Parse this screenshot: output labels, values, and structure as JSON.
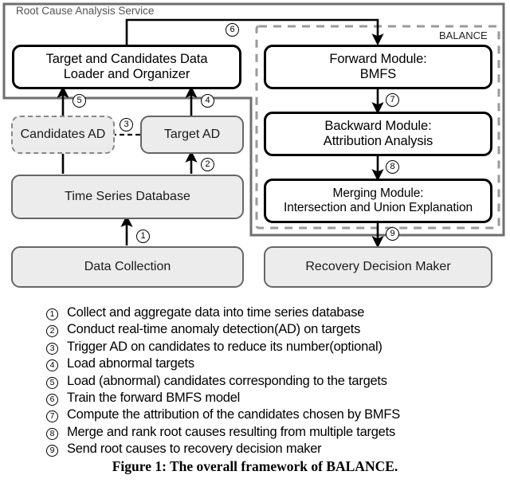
{
  "containers": {
    "service": {
      "label": "Root Cause Analysis Service"
    },
    "balance": {
      "label": "BALANCE"
    }
  },
  "nodes": {
    "data_loader": {
      "line1": "Target and Candidates Data",
      "line2": "Loader and Organizer"
    },
    "forward": {
      "line1": "Forward Module:",
      "line2": "BMFS"
    },
    "backward": {
      "line1": "Backward Module:",
      "line2": "Attribution Analysis"
    },
    "merging": {
      "line1": "Merging Module:",
      "line2": "Intersection and Union Explanation"
    },
    "candidates_ad": {
      "line1": "Candidates AD"
    },
    "target_ad": {
      "line1": "Target AD"
    },
    "tsdb": {
      "line1": "Time Series Database"
    },
    "data_collect": {
      "line1": "Data Collection"
    },
    "recovery": {
      "line1": "Recovery Decision Maker"
    }
  },
  "steps": {
    "s1": "1",
    "s2": "2",
    "s3": "3",
    "s4": "4",
    "s5": "5",
    "s6": "6",
    "s7": "7",
    "s8": "8",
    "s9": "9"
  },
  "legend": [
    {
      "num": "1",
      "text": "Collect and aggregate data into time series database"
    },
    {
      "num": "2",
      "text": "Conduct real-time anomaly detection(AD) on targets"
    },
    {
      "num": "3",
      "text": "Trigger AD on candidates to reduce its number(optional)"
    },
    {
      "num": "4",
      "text": "Load abnormal targets"
    },
    {
      "num": "5",
      "text": "Load (abnormal) candidates corresponding to the targets"
    },
    {
      "num": "6",
      "text": "Train the forward BMFS model"
    },
    {
      "num": "7",
      "text": "Compute the attribution of the candidates chosen by BMFS"
    },
    {
      "num": "8",
      "text": "Merge and rank root causes resulting from multiple targets"
    },
    {
      "num": "9",
      "text": "Send root causes to recovery decision maker"
    }
  ],
  "caption": "Figure 1: The overall framework of BALANCE.",
  "colors": {
    "node_stroke": "#000000",
    "store_stroke": "#666666",
    "store_fill": "#ececec",
    "container_stroke": "#6e6e6e",
    "balance_stroke": "#9a9a9a"
  }
}
